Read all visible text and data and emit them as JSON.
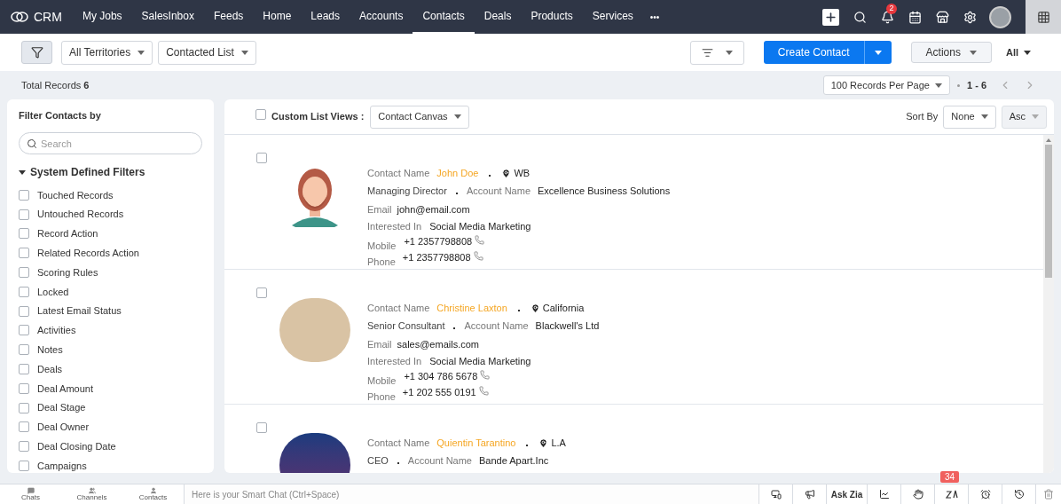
{
  "nav": {
    "brand": "CRM",
    "tabs": [
      {
        "label": "My Jobs",
        "selected": false
      },
      {
        "label": "SalesInbox",
        "selected": false
      },
      {
        "label": "Feeds",
        "selected": false
      },
      {
        "label": "Home",
        "selected": false
      },
      {
        "label": "Leads",
        "selected": false
      },
      {
        "label": "Accounts",
        "selected": false
      },
      {
        "label": "Contacts",
        "selected": true
      },
      {
        "label": "Deals",
        "selected": false
      },
      {
        "label": "Products",
        "selected": false
      },
      {
        "label": "Services",
        "selected": false
      }
    ],
    "more": "•••",
    "notifications": "2"
  },
  "toolbar": {
    "territory": "All Territories",
    "list": "Contacted List",
    "create": "Create Contact",
    "actions": "Actions",
    "all": "All"
  },
  "records": {
    "label": "Total Records",
    "count": "6",
    "per_page": "100 Records Per Page",
    "range": "1 - 6"
  },
  "filters": {
    "title": "Filter Contacts by",
    "search_placeholder": "Search",
    "section": "System Defined Filters",
    "expanded": true,
    "items": [
      {
        "label": "Touched Records",
        "checked": false
      },
      {
        "label": "Untouched Records",
        "checked": false
      },
      {
        "label": "Record Action",
        "checked": false
      },
      {
        "label": "Related Records Action",
        "checked": false
      },
      {
        "label": "Scoring Rules",
        "checked": false
      },
      {
        "label": "Locked",
        "checked": false
      },
      {
        "label": "Latest Email Status",
        "checked": false
      },
      {
        "label": "Activities",
        "checked": false
      },
      {
        "label": "Notes",
        "checked": false
      },
      {
        "label": "Deals",
        "checked": false
      },
      {
        "label": "Deal Amount",
        "checked": false
      },
      {
        "label": "Deal Stage",
        "checked": false
      },
      {
        "label": "Deal Owner",
        "checked": false
      },
      {
        "label": "Deal Closing Date",
        "checked": false
      },
      {
        "label": "Campaigns",
        "checked": false
      }
    ]
  },
  "list": {
    "select_all_checked": false,
    "views_label": "Custom List Views :",
    "view": "Contact Canvas",
    "sort_label": "Sort By",
    "sort": "None",
    "order": "Asc",
    "contacts": [
      {
        "kind": "cartoon",
        "checked": false,
        "name_label": "Contact Name",
        "name": "John Doe",
        "location": "WB",
        "title": "Managing Director",
        "account_label": "Account Name",
        "account": "Excellence Business Solutions",
        "email_label": "Email",
        "email": "john@email.com",
        "interest_label": "Interested In",
        "interest": "Social Media Marketing",
        "mobile_label": "Mobile",
        "mobile": "+1 2357798808",
        "phone_label": "Phone",
        "phone": "+1 2357798808"
      },
      {
        "kind": "photo",
        "checked": false,
        "name_label": "Contact Name",
        "name": "Christine Laxton",
        "location": "California",
        "title": "Senior Consultant",
        "account_label": "Account Name",
        "account": "Blackwell's Ltd",
        "email_label": "Email",
        "email": "sales@emails.com",
        "interest_label": "Interested In",
        "interest": "Social Media Marketing",
        "mobile_label": "Mobile",
        "mobile": "+1 304 786 5678",
        "phone_label": "Phone",
        "phone": "+1 202 555 0191"
      },
      {
        "kind": "logo",
        "checked": false,
        "name_label": "Contact Name",
        "name": "Quientin Tarantino",
        "location": "L.A",
        "title": "CEO",
        "account_label": "Account Name",
        "account": "Bande Apart.Inc"
      }
    ]
  },
  "bottom_bar": {
    "shortcuts": [
      "Chats",
      "Channels",
      "Contacts"
    ],
    "chat_placeholder": "Here is your Smart Chat (Ctrl+Space)",
    "ask_zia": "Ask Zia",
    "zia_badge": "34"
  }
}
